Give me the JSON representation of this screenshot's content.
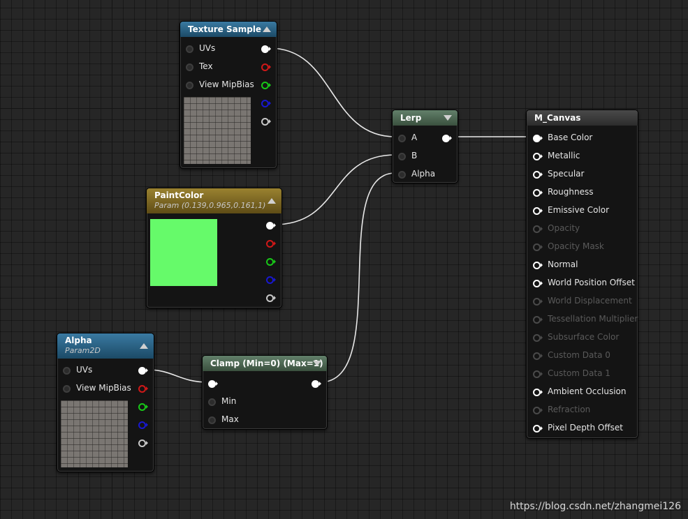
{
  "colors": {
    "texture_header": "#2e6a8e",
    "paintcolor_header": "#8a7324",
    "alpha_header": "#2e6a8e",
    "lerp_header": "#4e6a4e",
    "clamp_header": "#4e6a4e",
    "mcanvas_header": "#3c3c3c",
    "paintcolor_swatch": "#66fa6a",
    "pin_red": "#d01818",
    "pin_green": "#18c818",
    "pin_blue": "#1818d0",
    "pin_white": "#ffffff",
    "pin_gray": "#c8c8c8"
  },
  "texture_sample": {
    "title": "Texture Sample",
    "inputs": [
      "UVs",
      "Tex",
      "View MipBias"
    ]
  },
  "paint_color": {
    "title": "PaintColor",
    "subtitle": "Param (0.139,0.965,0.161,1)"
  },
  "alpha": {
    "title": "Alpha",
    "subtitle": "Param2D",
    "inputs": [
      "UVs",
      "View MipBias"
    ]
  },
  "lerp": {
    "title": "Lerp",
    "inputs": [
      "A",
      "B",
      "Alpha"
    ]
  },
  "clamp": {
    "title": "Clamp (Min=0) (Max=1)",
    "inputs": [
      "Min",
      "Max"
    ]
  },
  "m_canvas": {
    "title": "M_Canvas",
    "inputs": [
      {
        "label": "Base Color",
        "active": true
      },
      {
        "label": "Metallic",
        "active": true
      },
      {
        "label": "Specular",
        "active": true
      },
      {
        "label": "Roughness",
        "active": true
      },
      {
        "label": "Emissive Color",
        "active": true
      },
      {
        "label": "Opacity",
        "active": false
      },
      {
        "label": "Opacity Mask",
        "active": false
      },
      {
        "label": "Normal",
        "active": true
      },
      {
        "label": "World Position Offset",
        "active": true
      },
      {
        "label": "World Displacement",
        "active": false
      },
      {
        "label": "Tessellation Multiplier",
        "active": false
      },
      {
        "label": "Subsurface Color",
        "active": false
      },
      {
        "label": "Custom Data 0",
        "active": false
      },
      {
        "label": "Custom Data 1",
        "active": false
      },
      {
        "label": "Ambient Occlusion",
        "active": true
      },
      {
        "label": "Refraction",
        "active": false
      },
      {
        "label": "Pixel Depth Offset",
        "active": true
      }
    ]
  },
  "watermark": "https://blog.csdn.net/zhangmei126"
}
